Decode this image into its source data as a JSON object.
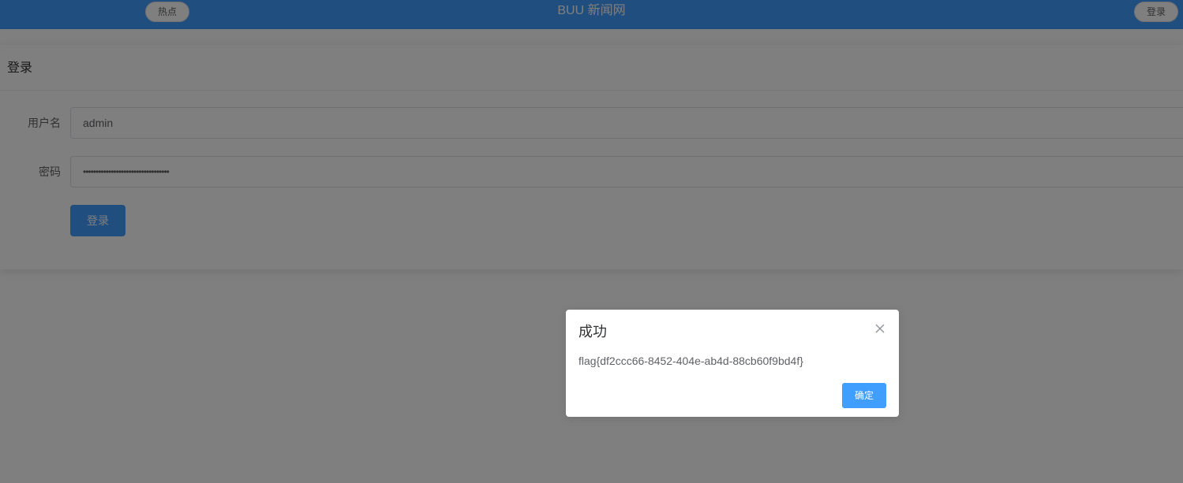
{
  "header": {
    "hot_label": "热点",
    "site_title": "BUU 新闻网",
    "login_label": "登录"
  },
  "login_card": {
    "title": "登录",
    "username_label": "用户名",
    "username_value": "admin",
    "password_label": "密码",
    "password_masked": "••••••••••••••••••••••••••••••••••",
    "submit_label": "登录"
  },
  "dialog": {
    "title": "成功",
    "message": "flag{df2ccc66-8452-404e-ab4d-88cb60f9bd4f}",
    "confirm_label": "确定"
  },
  "colors": {
    "accent": "#409eff",
    "overlay": "rgba(0,0,0,0.5)"
  },
  "icons": {
    "dialog_close": "close-icon"
  }
}
